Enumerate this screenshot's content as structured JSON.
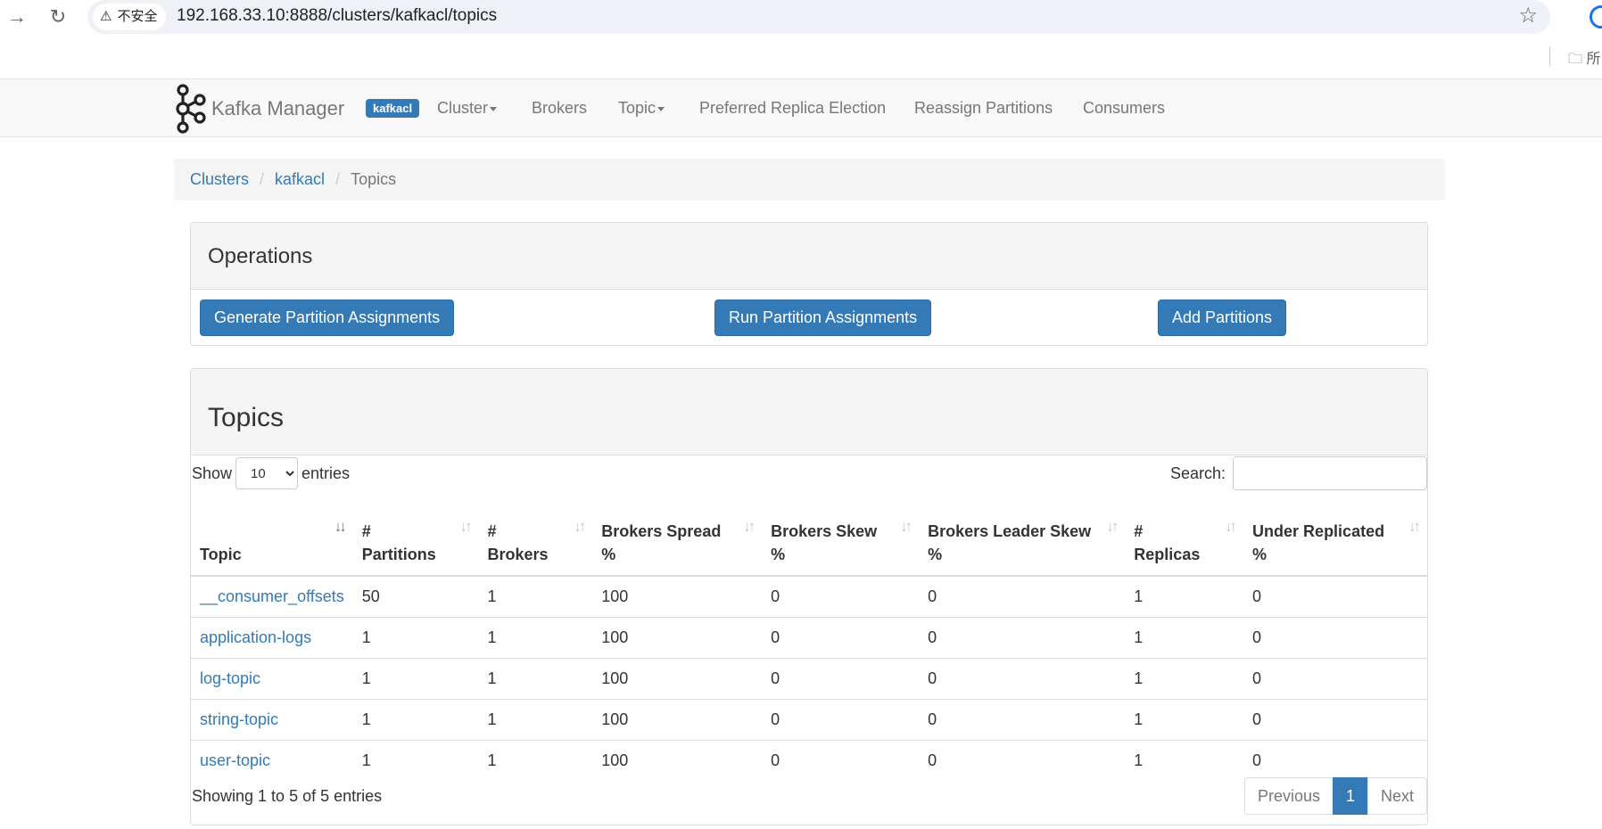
{
  "browser": {
    "security_label": "不安全",
    "url": "192.168.33.10:8888/clusters/kafkacl/topics",
    "bookmark_folder_label": "所"
  },
  "navbar": {
    "brand": "Kafka Manager",
    "cluster_badge": "kafkacl",
    "items": [
      "Cluster",
      "Brokers",
      "Topic",
      "Preferred Replica Election",
      "Reassign Partitions",
      "Consumers"
    ]
  },
  "breadcrumb": {
    "items": [
      "Clusters",
      "kafkacl",
      "Topics"
    ]
  },
  "operations": {
    "title": "Operations",
    "buttons": [
      "Generate Partition Assignments",
      "Run Partition Assignments",
      "Add Partitions"
    ]
  },
  "topics": {
    "title": "Topics",
    "show_label": "Show",
    "entries_label": "entries",
    "page_size": "10",
    "search_label": "Search:",
    "columns": [
      [
        "",
        "Topic"
      ],
      [
        "#",
        "Partitions"
      ],
      [
        "#",
        "Brokers"
      ],
      [
        "Brokers Spread",
        "%"
      ],
      [
        "Brokers Skew",
        "%"
      ],
      [
        "Brokers Leader Skew",
        "%"
      ],
      [
        "#",
        "Replicas"
      ],
      [
        "Under Replicated",
        "%"
      ]
    ],
    "rows": [
      [
        "__consumer_offsets",
        "50",
        "1",
        "100",
        "0",
        "0",
        "1",
        "0"
      ],
      [
        "application-logs",
        "1",
        "1",
        "100",
        "0",
        "0",
        "1",
        "0"
      ],
      [
        "log-topic",
        "1",
        "1",
        "100",
        "0",
        "0",
        "1",
        "0"
      ],
      [
        "string-topic",
        "1",
        "1",
        "100",
        "0",
        "0",
        "1",
        "0"
      ],
      [
        "user-topic",
        "1",
        "1",
        "100",
        "0",
        "0",
        "1",
        "0"
      ]
    ],
    "info": "Showing 1 to 5 of 5 entries",
    "pagination": {
      "previous": "Previous",
      "current": "1",
      "next": "Next"
    }
  },
  "colors": {
    "primary": "#337ab7",
    "navbar_bg": "#f8f8f8",
    "panel_heading_bg": "#f5f5f5"
  }
}
